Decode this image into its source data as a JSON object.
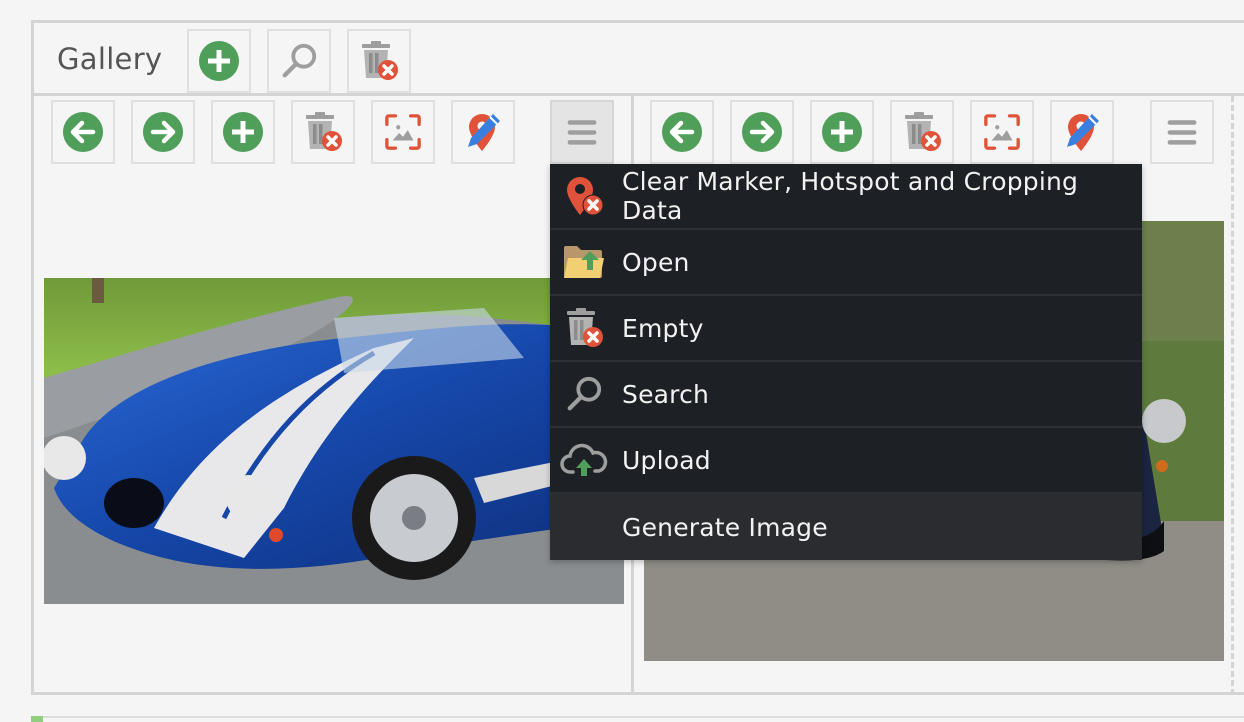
{
  "gallery": {
    "title": "Gallery",
    "header_buttons": [
      {
        "name": "add",
        "icon": "plus-circle-icon"
      },
      {
        "name": "search",
        "icon": "search-icon"
      },
      {
        "name": "empty",
        "icon": "trash-delete-icon"
      }
    ]
  },
  "panels": [
    {
      "toolbar": [
        {
          "name": "move-left",
          "icon": "arrow-left-circle-icon"
        },
        {
          "name": "move-right",
          "icon": "arrow-right-circle-icon"
        },
        {
          "name": "add",
          "icon": "plus-circle-icon"
        },
        {
          "name": "delete",
          "icon": "trash-delete-icon"
        },
        {
          "name": "crop",
          "icon": "crop-image-icon"
        },
        {
          "name": "edit-marker",
          "icon": "marker-edit-icon"
        },
        {
          "name": "menu",
          "icon": "hamburger-menu-icon",
          "active": true
        }
      ],
      "image": {
        "alt": "Blue roadster with white stripes on a curved driveway"
      }
    },
    {
      "toolbar": [
        {
          "name": "move-left",
          "icon": "arrow-left-circle-icon"
        },
        {
          "name": "move-right",
          "icon": "arrow-right-circle-icon"
        },
        {
          "name": "add",
          "icon": "plus-circle-icon"
        },
        {
          "name": "delete",
          "icon": "trash-delete-icon"
        },
        {
          "name": "crop",
          "icon": "crop-image-icon"
        },
        {
          "name": "edit-marker",
          "icon": "marker-edit-icon"
        },
        {
          "name": "menu",
          "icon": "hamburger-menu-icon",
          "active": false
        }
      ],
      "image": {
        "alt": "Dark blue classic car in front of green hedge"
      }
    }
  ],
  "context_menu": {
    "items": [
      {
        "label": "Clear Marker, Hotspot and Cropping Data",
        "icon": "marker-clear-icon"
      },
      {
        "label": "Open",
        "icon": "folder-open-icon"
      },
      {
        "label": "Empty",
        "icon": "trash-delete-icon"
      },
      {
        "label": "Search",
        "icon": "search-icon"
      },
      {
        "label": "Upload",
        "icon": "cloud-upload-icon"
      },
      {
        "label": "Generate Image",
        "icon": ""
      }
    ]
  },
  "colors": {
    "green": "#4f9e59",
    "red": "#e0533a",
    "blue": "#3a7ee0",
    "gray_icon": "#9e9e9e",
    "menu_bg": "#1d2024"
  }
}
